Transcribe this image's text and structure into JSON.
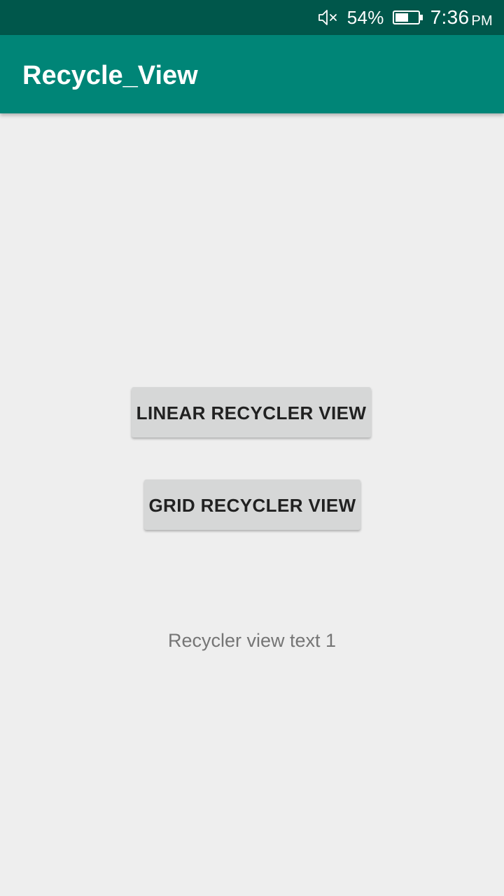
{
  "status_bar": {
    "battery_percent": "54%",
    "time": "7:36",
    "am_pm": "PM",
    "icons": [
      "mute-icon",
      "battery-icon"
    ],
    "battery_level": 0.54
  },
  "app_bar": {
    "title": "Recycle_View"
  },
  "main": {
    "linear_button_label": "LINEAR RECYCLER VIEW",
    "grid_button_label": "GRID RECYCLER VIEW",
    "recycler_text": "Recycler view text 1"
  },
  "colors": {
    "status_bar": "#00574b",
    "app_bar": "#008577",
    "background": "#eeeeee",
    "button": "#d6d7d7"
  }
}
